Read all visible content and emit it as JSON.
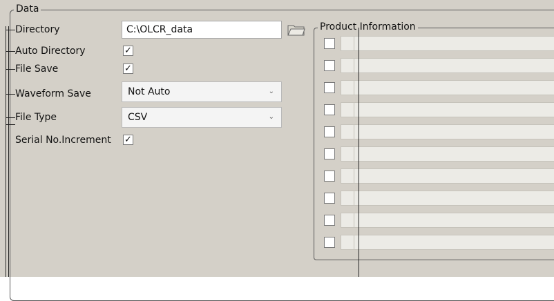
{
  "data_group": {
    "title": "Data",
    "directory": {
      "label": "Directory",
      "value": "C:\\OLCR_data"
    },
    "auto_directory": {
      "label": "Auto Directory",
      "checked": true,
      "mark": "✓"
    },
    "file_save": {
      "label": "File Save",
      "checked": true,
      "mark": "✓"
    },
    "waveform_save": {
      "label": "Waveform Save",
      "value": "Not Auto"
    },
    "file_type": {
      "label": "File Type",
      "value": "CSV"
    },
    "serial_increment": {
      "label": "Serial No.Increment",
      "checked": true,
      "mark": "✓"
    }
  },
  "product_information": {
    "title": "Product Information",
    "rows": [
      {
        "checked": false,
        "value": ""
      },
      {
        "checked": false,
        "value": ""
      },
      {
        "checked": false,
        "value": ""
      },
      {
        "checked": false,
        "value": ""
      },
      {
        "checked": false,
        "value": ""
      },
      {
        "checked": false,
        "value": ""
      },
      {
        "checked": false,
        "value": ""
      },
      {
        "checked": false,
        "value": ""
      },
      {
        "checked": false,
        "value": ""
      },
      {
        "checked": false,
        "value": ""
      }
    ]
  },
  "icons": {
    "folder": "folder-icon",
    "dropdown": "chevron-down-icon"
  },
  "colors": {
    "panel_bg": "#d4d0c8",
    "field_bg": "#ecebe6",
    "input_bg": "#ffffff"
  }
}
